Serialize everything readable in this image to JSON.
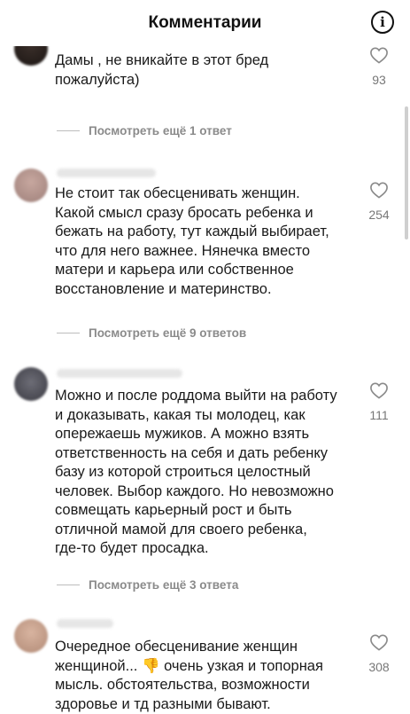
{
  "header": {
    "title": "Комментарии",
    "info_icon": "info-icon"
  },
  "comments": [
    {
      "text": "Дамы , не вникайте в этот бред\nпожалуйста)",
      "likes": "93"
    },
    {
      "text": "Не стоит так обесценивать женщин.\nКакой смысл сразу бросать ребенка и\nбежать на работу, тут каждый выбирает,\nчто для него важнее. Нянечка вместо\nматери и карьера или собственное\nвосстановление и материнство.",
      "likes": "254"
    },
    {
      "text": "Можно и после роддома выйти на работу\nи доказывать, какая ты молодец, как\nопережаешь мужиков. А можно взять\nответственность на себя и дать ребенку\nбазу из которой строиться целостный\nчеловек. Выбор каждого. Но невозможно\nсовмещать карьерный рост и быть\nотличной мамой для своего ребенка,\nгде-то будет просадка.",
      "likes": "111"
    },
    {
      "text": "Очередное обесценивание женщин\nженщиной... 👎 очень узкая и топорная\nмысль. обстоятельства, возможности\nздоровье и тд разными бывают.",
      "likes": "308"
    }
  ],
  "replies": [
    {
      "label": "Посмотреть ещё 1 ответ"
    },
    {
      "label": "Посмотреть ещё 9 ответов"
    },
    {
      "label": "Посмотреть ещё 3 ответа"
    }
  ],
  "colors": {
    "text": "#1a1a1a",
    "muted": "#8a8a8a",
    "line": "#bdbdbd"
  }
}
